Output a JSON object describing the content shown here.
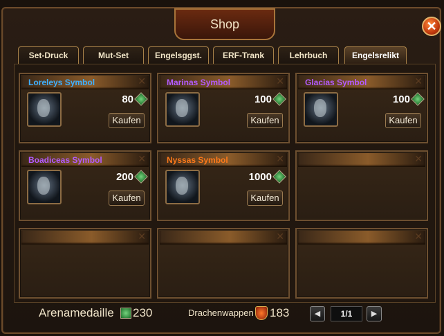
{
  "window": {
    "title": "Shop"
  },
  "close": {
    "glyph": "✕"
  },
  "tabs": [
    {
      "label": "Set-Druck"
    },
    {
      "label": "Mut-Set"
    },
    {
      "label": "Engelsggst."
    },
    {
      "label": "ERF-Trank"
    },
    {
      "label": "Lehrbuch"
    },
    {
      "label": "Engelsrelikt",
      "active": true
    }
  ],
  "items": [
    {
      "name": "Loreleys Symbol",
      "name_color": "#3fb0ff",
      "price": "80",
      "buy_label": "Kaufen"
    },
    {
      "name": "Marinas Symbol",
      "name_color": "#b45bff",
      "price": "100",
      "buy_label": "Kaufen"
    },
    {
      "name": "Glacias Symbol",
      "name_color": "#b45bff",
      "price": "100",
      "buy_label": "Kaufen"
    },
    {
      "name": "Boadiceas Symbol",
      "name_color": "#b45bff",
      "price": "200",
      "buy_label": "Kaufen"
    },
    {
      "name": "Nyssas Symbol",
      "name_color": "#ff7a1a",
      "price": "1000",
      "buy_label": "Kaufen"
    }
  ],
  "footer": {
    "arena_label": "Arenamedaille",
    "arena_value": "230",
    "dragon_label": "Drachenwappen",
    "dragon_value": "183",
    "page": "1/1"
  },
  "icons": {
    "currency": "green-gem-icon",
    "arena": "arena-medal-icon",
    "dragon": "dragon-crest-icon",
    "prev": "◀",
    "next": "▶"
  }
}
